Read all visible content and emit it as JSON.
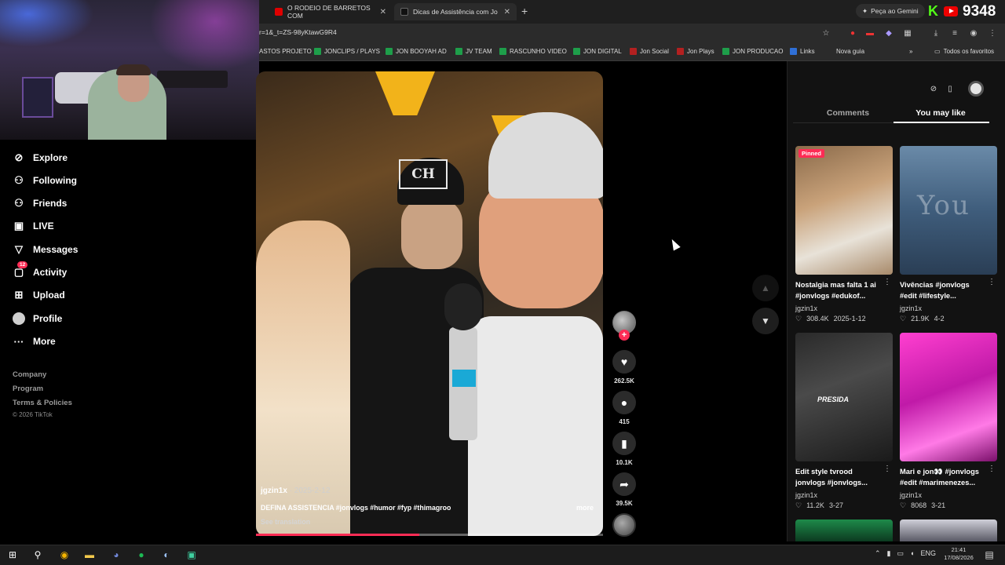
{
  "browser": {
    "tabs": [
      {
        "title": "O RODEIO DE BARRETOS COM",
        "favicon_color": "#e00000"
      },
      {
        "title": "Dicas de Assistência com Jo",
        "favicon_color": "#222222",
        "active": true
      }
    ],
    "new_tab_label": "+",
    "gemini_label": "Peça ao Gemini",
    "viewer_count": "9348",
    "url": "r=1&_t=ZS-98yKtawG9R4",
    "bookmarks": [
      {
        "label": "ASTOS PROJETO",
        "icon": "none"
      },
      {
        "label": "JONCLIPS / PLAYS",
        "icon": "green"
      },
      {
        "label": "JON BOOYAH AD",
        "icon": "green"
      },
      {
        "label": "JV TEAM",
        "icon": "green"
      },
      {
        "label": "RASCUNHO VIDEO",
        "icon": "green"
      },
      {
        "label": "JON DIGITAL",
        "icon": "green"
      },
      {
        "label": "Jon Social",
        "icon": "red"
      },
      {
        "label": "Jon Plays",
        "icon": "red"
      },
      {
        "label": "JON PRODUCAO",
        "icon": "green"
      },
      {
        "label": "Links",
        "icon": "blue"
      },
      {
        "label": "Nova guia",
        "icon": "none"
      }
    ],
    "all_bookmarks_label": "Todos os favoritos"
  },
  "sidebar": {
    "items": [
      {
        "label": "Explore",
        "icon": "compass-icon",
        "glyph": "⊘"
      },
      {
        "label": "Following",
        "icon": "person-icon",
        "glyph": "⚇"
      },
      {
        "label": "Friends",
        "icon": "friends-icon",
        "glyph": "⚇"
      },
      {
        "label": "LIVE",
        "icon": "live-icon",
        "glyph": "▣"
      },
      {
        "label": "Messages",
        "icon": "send-icon",
        "glyph": "▽"
      },
      {
        "label": "Activity",
        "icon": "activity-icon",
        "glyph": "▢",
        "badge": "12"
      },
      {
        "label": "Upload",
        "icon": "upload-icon",
        "glyph": "⊞"
      },
      {
        "label": "Profile",
        "icon": "avatar-icon"
      },
      {
        "label": "More",
        "icon": "more-icon",
        "glyph": "···"
      }
    ],
    "footer": [
      "Company",
      "Program",
      "Terms & Policies"
    ],
    "copyright": "© 2026 TikTok"
  },
  "video": {
    "author": "jgzin1x",
    "date": "2025-2-12",
    "description": "DEFINA ASSISTENCIA #jonvlogs #humor #fyp #thimagroo",
    "more_label": "more",
    "translation_label": "See translation",
    "cap_logo": "CH",
    "progress_fraction": 0.47,
    "likes": "262.5K",
    "comments": "415",
    "saves": "10.1K",
    "shares": "39.5K",
    "follow_glyph": "+"
  },
  "right_panel": {
    "tabs": {
      "comments": "Comments",
      "you_may_like": "You may like"
    },
    "cards": [
      {
        "title": "Nostalgia mas falta 1 ai #jonvlogs #edukof...",
        "author": "jgzin1x",
        "views": "308.4K",
        "date": "2025-1-12",
        "pinned": "Pinned"
      },
      {
        "title": "Vivências #jonvlogs #edit #lifestyle...",
        "author": "jgzin1x",
        "views": "21.9K",
        "date": "4-2",
        "overlay": "You"
      },
      {
        "title": "Edit style tvrood jonvlogs #jonvlogs...",
        "author": "jgzin1x",
        "views": "11.2K",
        "date": "3-27",
        "overlay": "PRESIDA"
      },
      {
        "title": "Mari e jon👀 #jonvlogs #edit #marimenezes...",
        "author": "jgzin1x",
        "views": "8068",
        "date": "3-21"
      }
    ]
  },
  "taskbar": {
    "lang": "ENG",
    "time": "21:41",
    "date": "17/08/2026"
  }
}
